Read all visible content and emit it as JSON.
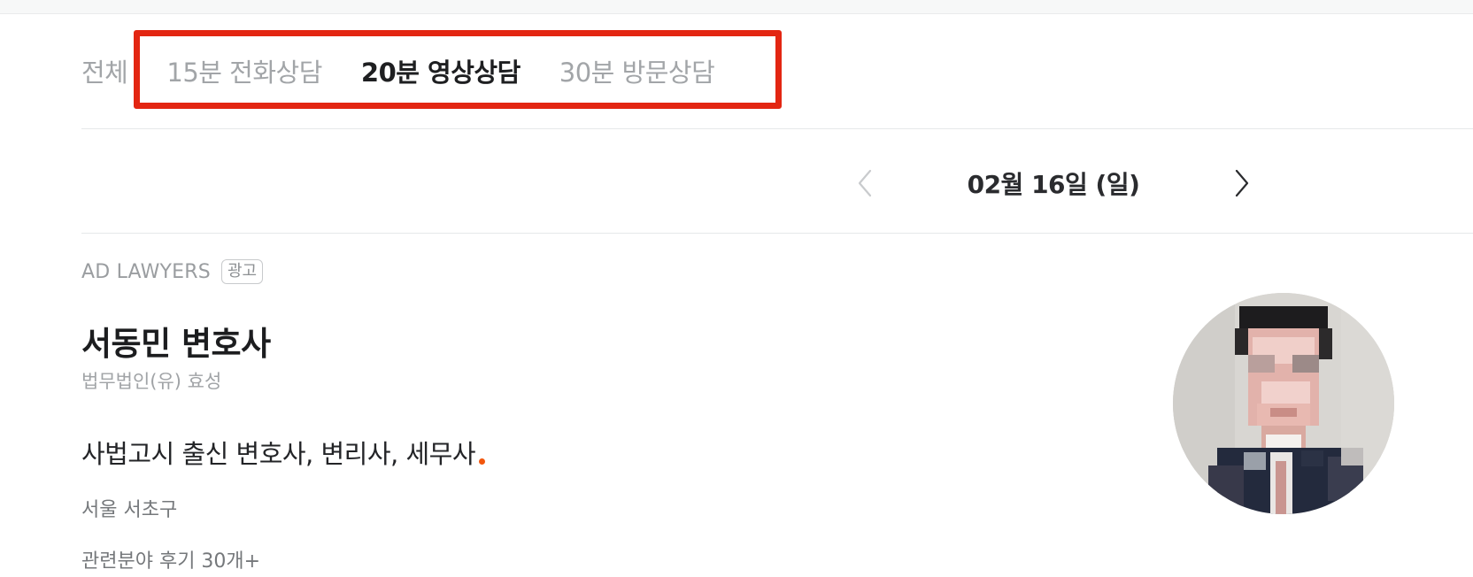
{
  "tabs": [
    {
      "label": "전체",
      "active": false
    },
    {
      "label": "15분 전화상담",
      "active": false
    },
    {
      "label": "20분 영상상담",
      "active": true
    },
    {
      "label": "30분 방문상담",
      "active": false
    }
  ],
  "date_nav": {
    "date_label": "02월 16일 (일)",
    "prev_icon": "chevron-left-icon",
    "next_icon": "chevron-right-icon"
  },
  "card": {
    "ad_label": "AD LAWYERS",
    "ad_badge": "광고",
    "name": "서동민 변호사",
    "firm": "법무법인(유) 효성",
    "headline": "사법고시 출신 변호사, 변리사, 세무사",
    "location": "서울 서초구",
    "reviews": "관련분야 후기 30개+"
  },
  "colors": {
    "highlight": "#e32612",
    "accent_dot": "#f2560d",
    "active_tab": "#1e1f21",
    "inactive_tab": "#a2a5a8"
  }
}
